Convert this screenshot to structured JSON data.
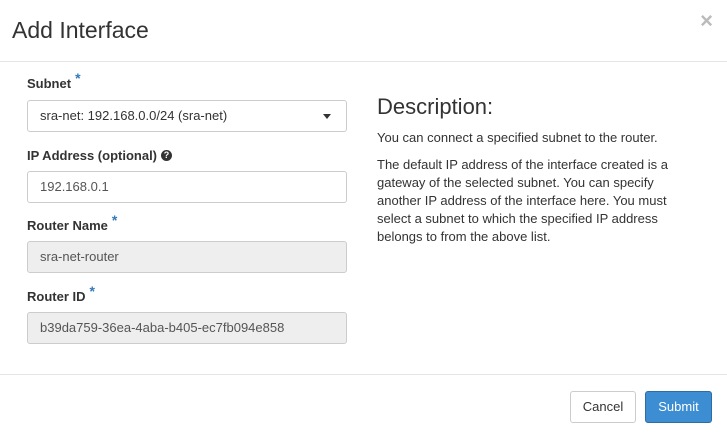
{
  "dialog": {
    "title": "Add Interface",
    "close_glyph": "×"
  },
  "form": {
    "subnet": {
      "label": "Subnet",
      "required_mark": "*",
      "selected": "sra-net: 192.168.0.0/24 (sra-net)"
    },
    "ip_address": {
      "label": "IP Address (optional)",
      "help_glyph": "?",
      "placeholder": "192.168.0.1"
    },
    "router_name": {
      "label": "Router Name",
      "required_mark": "*",
      "value": "sra-net-router"
    },
    "router_id": {
      "label": "Router ID",
      "required_mark": "*",
      "value": "b39da759-36ea-4aba-b405-ec7fb094e858"
    }
  },
  "description": {
    "title": "Description:",
    "paragraph_1": "You can connect a specified subnet to the router.",
    "paragraph_2": "The default IP address of the interface created is a gateway of the selected subnet. You can specify another IP address of the interface here. You must select a subnet to which the specified IP address belongs to from the above list."
  },
  "footer": {
    "cancel_label": "Cancel",
    "submit_label": "Submit"
  },
  "colors": {
    "accent": "#337ab7",
    "submit_bg": "#3c8dd2",
    "readonly_bg": "#eeeeee",
    "border": "#cccccc"
  },
  "icons": {
    "close": "close-icon",
    "dropdown": "chevron-down-icon",
    "help": "help-icon"
  }
}
